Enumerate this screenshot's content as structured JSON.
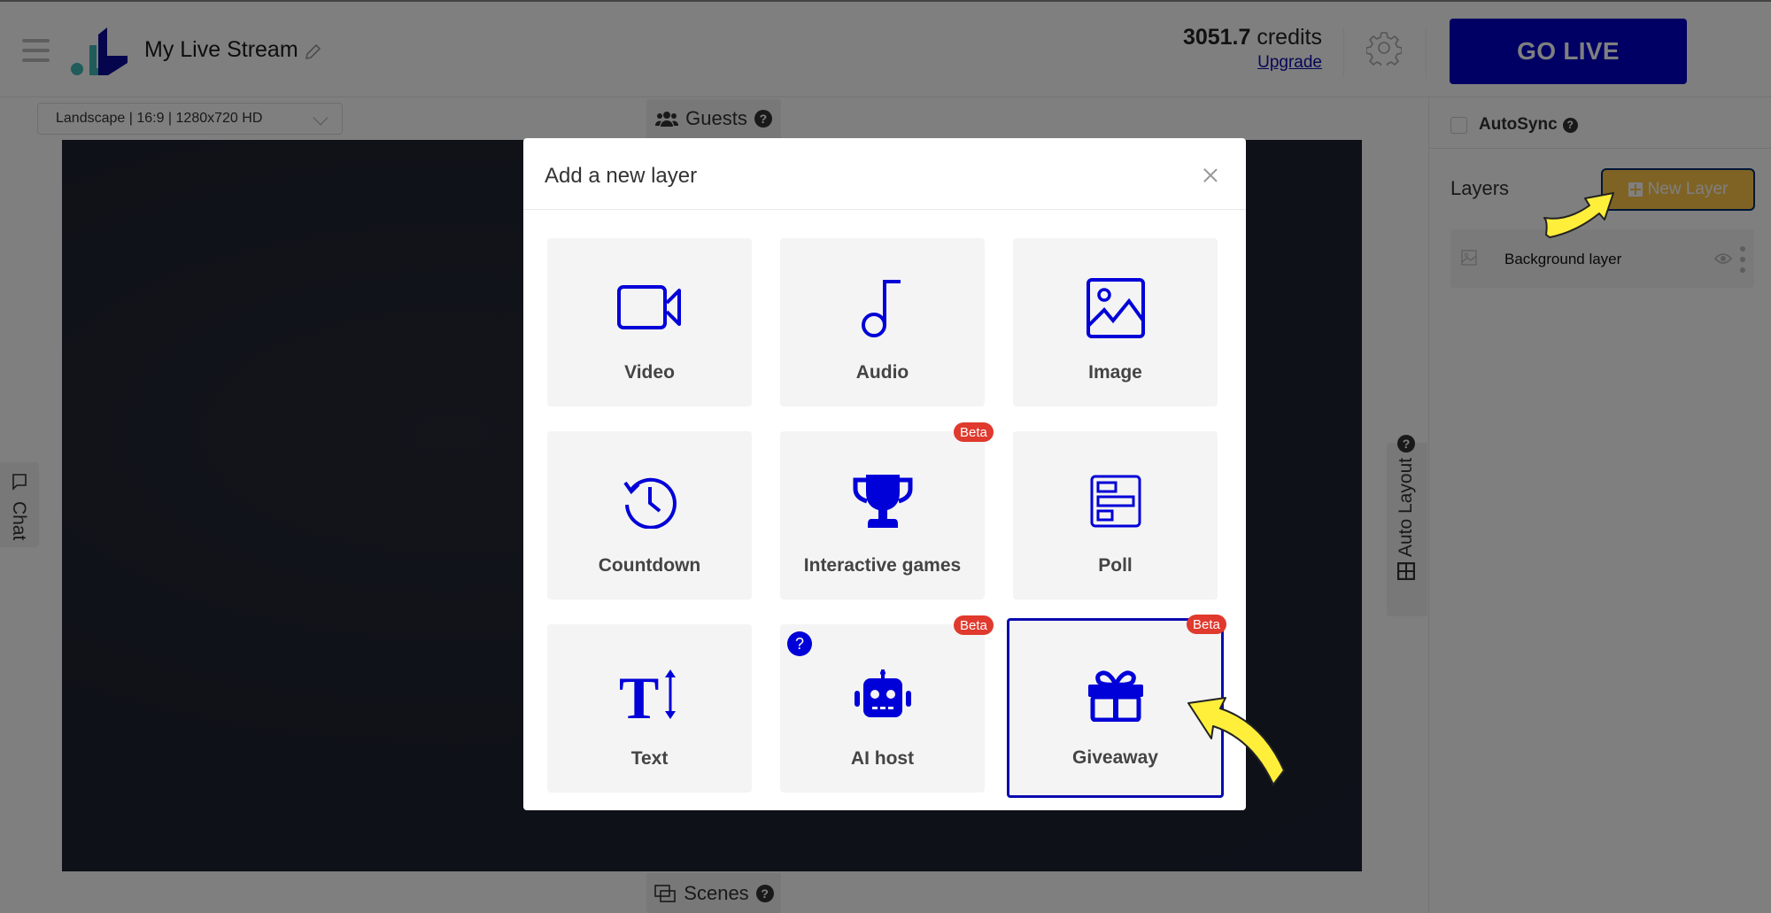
{
  "header": {
    "menu_icon": "hamburger-icon",
    "logo": "app-logo",
    "stream_title": "My Live Stream",
    "edit_icon": "pencil-icon",
    "credits_amount": "3051.7",
    "credits_unit": "credits",
    "upgrade_label": "Upgrade",
    "settings_icon": "gear-icon",
    "go_live_label": "GO LIVE"
  },
  "toolbar": {
    "resolution_value": "Landscape | 16:9 | 1280x720 HD",
    "guests_label": "Guests",
    "scenes_label": "Scenes",
    "help_glyph": "?"
  },
  "side_tabs": {
    "chat_label": "Chat",
    "auto_layout_label": "Auto Layout"
  },
  "right_panel": {
    "autosync_label": "AutoSync",
    "autosync_checked": false,
    "layers_label": "Layers",
    "new_layer_label": "New Layer",
    "layers": [
      {
        "name": "Background layer",
        "visible": true
      }
    ]
  },
  "modal": {
    "title": "Add a new layer",
    "close_icon": "close-icon",
    "options": [
      {
        "label": "Video",
        "icon": "video-camera-icon",
        "beta": false
      },
      {
        "label": "Audio",
        "icon": "music-note-icon",
        "beta": false
      },
      {
        "label": "Image",
        "icon": "image-icon",
        "beta": false
      },
      {
        "label": "Countdown",
        "icon": "clock-history-icon",
        "beta": false
      },
      {
        "label": "Interactive games",
        "icon": "trophy-icon",
        "beta": true
      },
      {
        "label": "Poll",
        "icon": "poll-icon",
        "beta": false
      },
      {
        "label": "Text",
        "icon": "text-height-icon",
        "beta": false
      },
      {
        "label": "AI host",
        "icon": "robot-icon",
        "beta": true,
        "help": true
      },
      {
        "label": "Giveaway",
        "icon": "gift-icon",
        "beta": true,
        "selected": true
      }
    ],
    "beta_label": "Beta",
    "help_glyph": "?"
  },
  "annotations": {
    "arrow_color": "#ffef3a"
  },
  "colors": {
    "brand_blue": "#0000c8",
    "icon_blue": "#0000d8",
    "beta_red": "#e0392d",
    "new_layer_yellow": "#ffc74a",
    "overlay": "rgba(0,0,0,0.5)"
  }
}
